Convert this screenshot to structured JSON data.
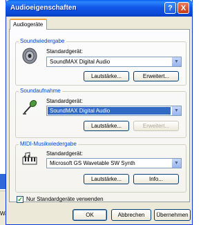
{
  "window": {
    "title": "Audioeigenschaften",
    "help_label": "?",
    "close_label": "X"
  },
  "background": {
    "partial_text": "Wa"
  },
  "tabs": [
    {
      "label": "Audiogeräte"
    }
  ],
  "playback": {
    "group_label": "Soundwiedergabe",
    "device_label": "Standardgerät:",
    "device_value": "SoundMAX Digital Audio",
    "volume_button": "Lautstärke...",
    "advanced_button": "Erweitert..."
  },
  "recording": {
    "group_label": "Soundaufnahme",
    "device_label": "Standardgerät:",
    "device_value": "SoundMAX Digital Audio",
    "volume_button": "Lautstärke...",
    "advanced_button": "Erweitert..."
  },
  "midi": {
    "group_label": "MIDI-Musikwiedergabe",
    "device_label": "Standardgerät:",
    "device_value": "Microsoft GS Wavetable SW Synth",
    "volume_button": "Lautstärke...",
    "info_button": "Info..."
  },
  "options": {
    "default_only_label": "Nur Standardgeräte verwenden",
    "default_only_checked": true
  },
  "buttons": {
    "ok": "OK",
    "cancel": "Abbrechen",
    "apply": "Übernehmen"
  },
  "icons": {
    "speaker": "speaker-icon",
    "microphone": "microphone-icon",
    "midi": "midi-keyboard-icon",
    "dropdown": "chevron-down-icon",
    "check": "checkmark-icon"
  },
  "colors": {
    "title_bar": "#0b4bd7",
    "selection": "#316ac5",
    "group_label": "#0046d5"
  }
}
